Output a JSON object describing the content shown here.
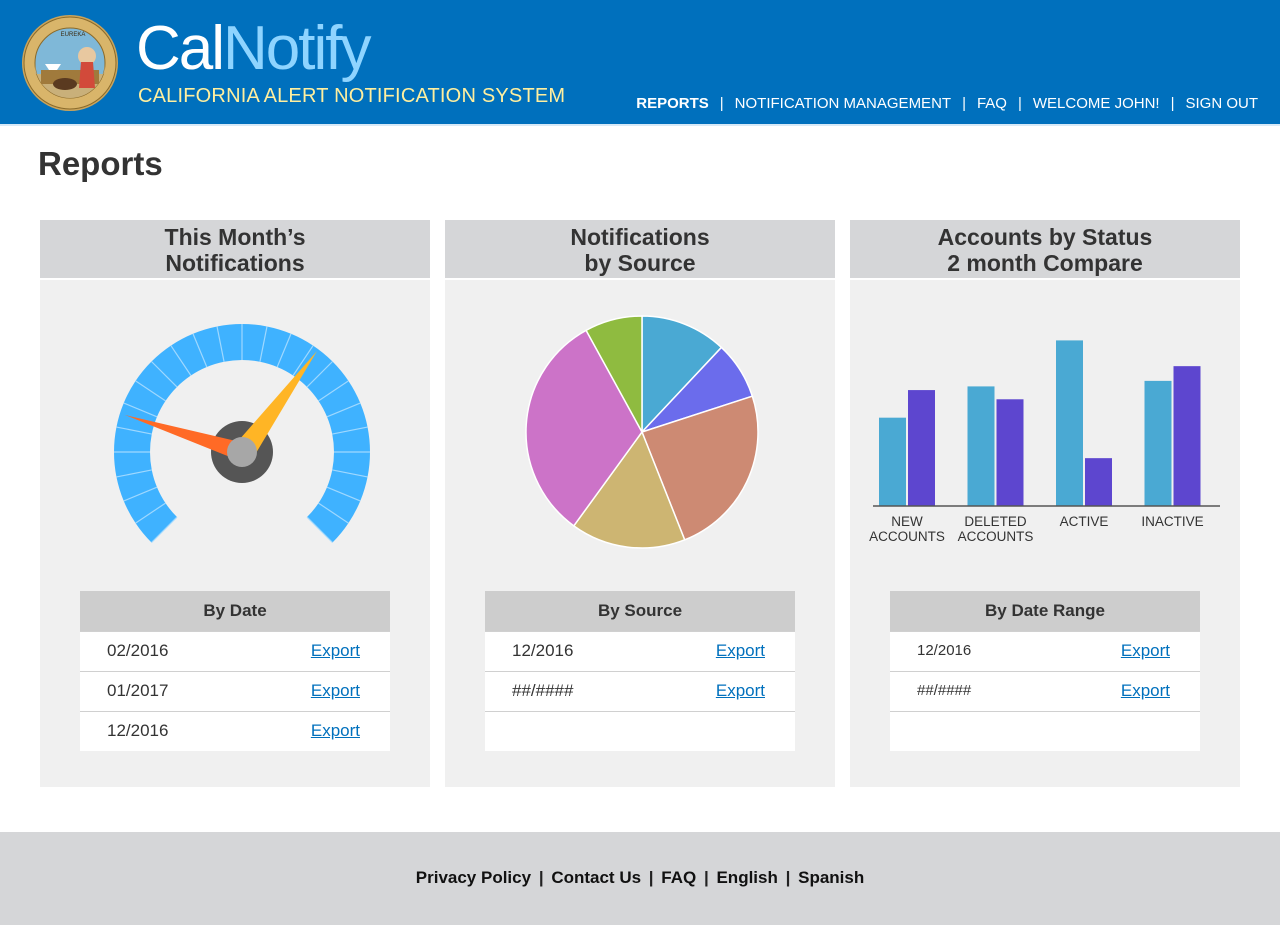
{
  "header": {
    "brand_part1": "Cal",
    "brand_part2": "Notify",
    "tagline": "CALIFORNIA ALERT NOTIFICATION SYSTEM",
    "seal_text": "THE GREAT SEAL OF THE STATE OF CALIFORNIA",
    "seal_motto": "EUREKA",
    "nav": [
      {
        "label": "REPORTS",
        "active": true
      },
      {
        "label": "NOTIFICATION MANAGEMENT",
        "active": false
      },
      {
        "label": "FAQ",
        "active": false
      },
      {
        "label": "WELCOME JOHN!",
        "active": false
      },
      {
        "label": "SIGN OUT",
        "active": false
      }
    ],
    "nav_separator": "|"
  },
  "page": {
    "title": "Reports"
  },
  "panels": [
    {
      "title_line1": "This Month’s",
      "title_line2": "Notifications",
      "gauge": {
        "gauge_color": "#3fb2ff",
        "needle_long_color": "#ffb525",
        "needle_short_color": "#ff6a26",
        "hub_color": "#555555"
      },
      "table": {
        "header": "By Date",
        "rows": [
          {
            "date": "02/2016",
            "action": "Export"
          },
          {
            "date": "01/2017",
            "action": "Export"
          },
          {
            "date": "12/2016",
            "action": "Export"
          }
        ]
      }
    },
    {
      "title_line1": "Notifications",
      "title_line2": "by Source",
      "pie_colors": [
        "#4aa9d3",
        "#6b6cec",
        "#cd8a73",
        "#cdb572",
        "#cc73c8",
        "#8fbb40"
      ],
      "table": {
        "header": "By Source",
        "rows": [
          {
            "date": "12/2016",
            "action": "Export"
          },
          {
            "date": "##/####",
            "action": "Export"
          }
        ]
      }
    },
    {
      "title_line1": "Accounts by Status",
      "title_line2": "2 month Compare",
      "table": {
        "header": "By Date Range",
        "rows": [
          {
            "date": "12/2016",
            "action": "Export"
          },
          {
            "date": "##/####",
            "action": "Export"
          }
        ]
      }
    }
  ],
  "chart_data": [
    {
      "type": "pie",
      "categories": [
        "",
        "",
        "",
        "",
        "",
        ""
      ],
      "values": [
        12,
        8,
        24,
        16,
        32,
        8
      ]
    },
    {
      "type": "bar",
      "categories": [
        "NEW ACCOUNTS",
        "DELETED ACCOUNTS",
        "ACTIVE",
        "INACTIVE"
      ],
      "category_lines": [
        [
          "NEW",
          "ACCOUNTS"
        ],
        [
          "DELETED",
          "ACCOUNTS"
        ],
        [
          "ACTIVE"
        ],
        [
          "INACTIVE"
        ]
      ],
      "series": [
        {
          "values": [
            48,
            65,
            90,
            68
          ],
          "color": "#4aa9d3"
        },
        {
          "values": [
            63,
            58,
            26,
            76
          ],
          "color": "#5d46cf"
        }
      ],
      "ylim": [
        0,
        100
      ]
    }
  ],
  "footer": {
    "links": [
      "Privacy Policy",
      "Contact Us",
      "FAQ",
      "English",
      "Spanish"
    ],
    "separator": "|"
  }
}
